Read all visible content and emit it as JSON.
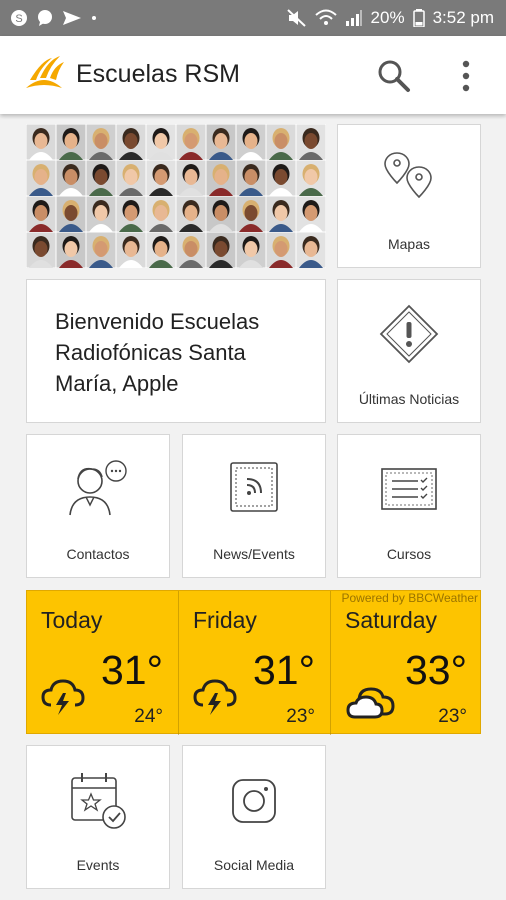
{
  "status_bar": {
    "battery": "20%",
    "time": "3:52 pm",
    "left_icons": [
      "skype-icon",
      "chat-icon",
      "send-icon",
      "dot-icon"
    ],
    "right_icons": [
      "mute-icon",
      "wifi-icon",
      "signal-icon",
      "battery-icon"
    ]
  },
  "app_bar": {
    "title": "Escuelas RSM",
    "accent": "#f5a800"
  },
  "tiles": {
    "maps": "Mapas",
    "welcome": "Bienvenido Escuelas Radiofónicas Santa María, Apple",
    "news": "Últimas Noticias",
    "contacts": "Contactos",
    "news_events": "News/Events",
    "courses": "Cursos",
    "events": "Events",
    "social": "Social Media"
  },
  "weather": {
    "powered_by": "Powered by BBCWeather",
    "background": "#fdc400",
    "days": [
      {
        "day": "Today",
        "high": "31°",
        "low": "24°",
        "icon": "thunderstorm-icon"
      },
      {
        "day": "Friday",
        "high": "31°",
        "low": "23°",
        "icon": "thunderstorm-icon"
      },
      {
        "day": "Saturday",
        "high": "33°",
        "low": "23°",
        "icon": "cloud-icon"
      }
    ]
  }
}
